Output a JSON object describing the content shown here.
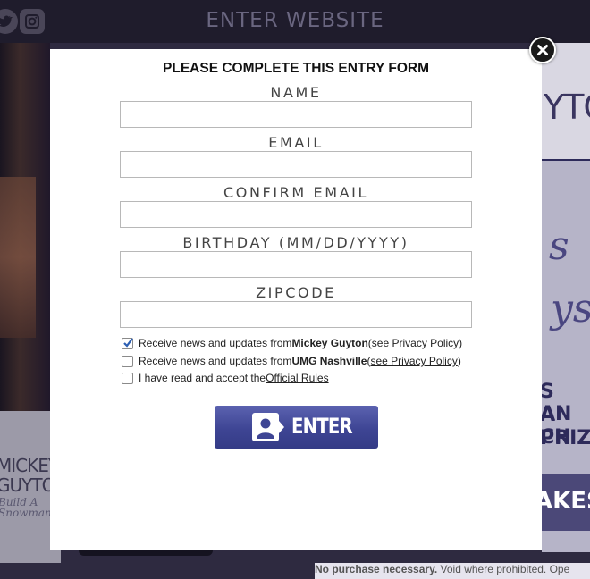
{
  "header": {
    "title": "ENTER WEBSITE",
    "social_icons": [
      "twitter-icon",
      "instagram-icon"
    ]
  },
  "background": {
    "album_title_line1": "MICKEY",
    "album_title_line2": "GUYTON",
    "album_script_line1": "Build A",
    "album_script_line2": "Snowman",
    "right_title_fragment": "YTO",
    "right_script1": "s",
    "right_script2": "ys",
    "right_bold_line1": "S AN",
    "right_bold_line2": "A CH",
    "right_bold_line3": "PRIZ",
    "sweep_fragment": "AKES",
    "footer_bold": "No purchase necessary.",
    "footer_text": " Void where prohibited. Ope"
  },
  "modal": {
    "title": "PLEASE COMPLETE THIS ENTRY FORM",
    "fields": [
      {
        "label": "NAME",
        "value": ""
      },
      {
        "label": "EMAIL",
        "value": ""
      },
      {
        "label": "CONFIRM EMAIL",
        "value": ""
      },
      {
        "label": "BIRTHDAY (MM/DD/YYYY)",
        "value": ""
      },
      {
        "label": "ZIPCODE",
        "value": ""
      }
    ],
    "checkboxes": [
      {
        "prefix": "Receive news and updates from ",
        "bold": "Mickey Guyton",
        "pre_link": " (",
        "link": "see Privacy Policy",
        "suffix": ")",
        "checked": true
      },
      {
        "prefix": "Receive news and updates from ",
        "bold": "UMG Nashville",
        "pre_link": " (",
        "link": "see Privacy Policy",
        "suffix": ")",
        "checked": false
      },
      {
        "prefix": "I have read and accept the ",
        "link": "Official Rules",
        "checked": false
      }
    ],
    "enter_label": "ENTER",
    "enter_icon": "facebook-user-icon",
    "close_icon": "close-icon"
  },
  "colors": {
    "enter_button": "#3e4594",
    "modal_bg": "#ffffff",
    "header_bg": "#1f1c2c"
  }
}
